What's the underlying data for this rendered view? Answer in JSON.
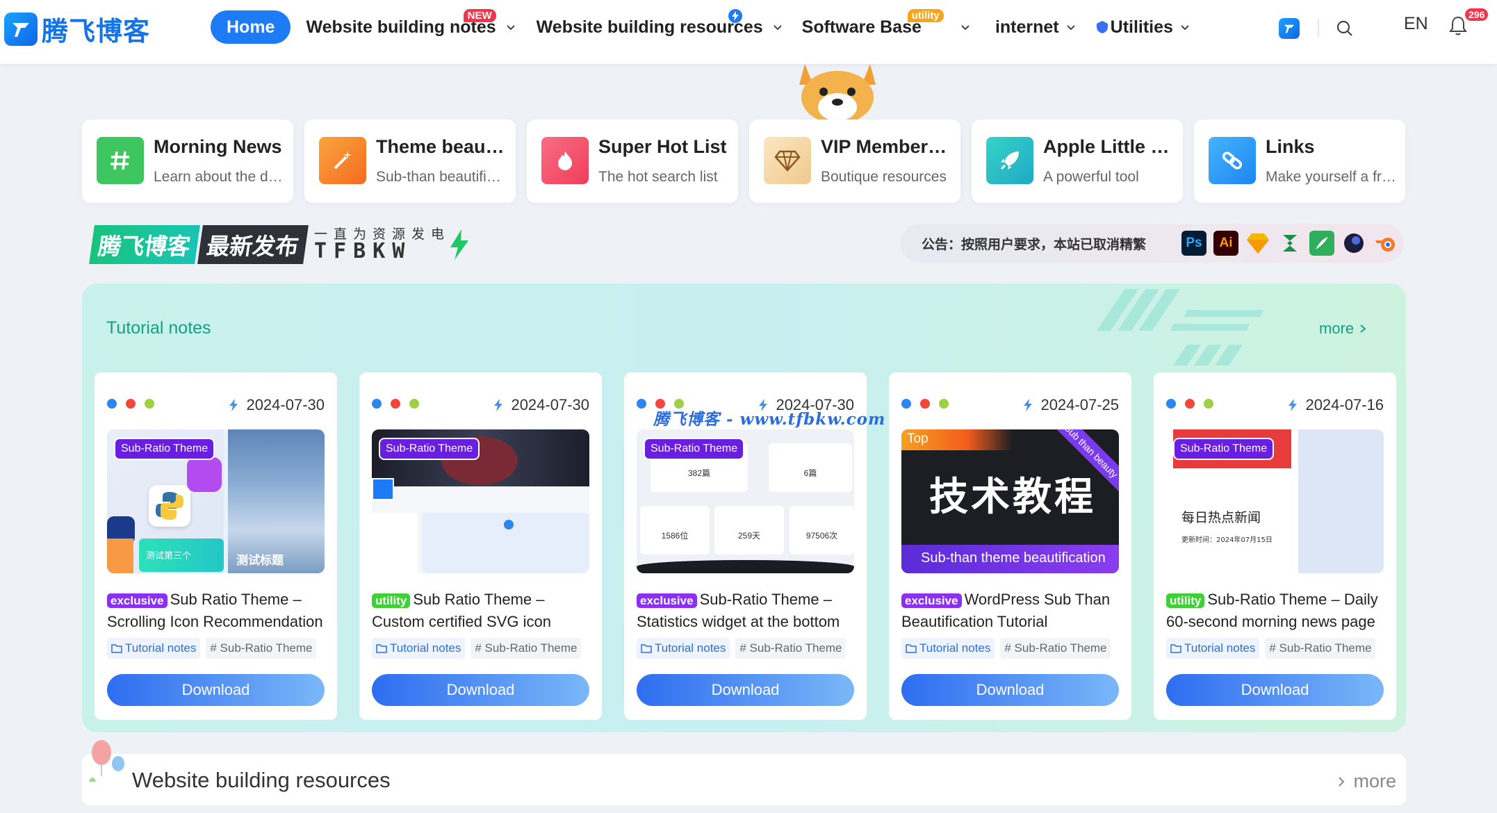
{
  "header": {
    "logo_text": "腾飞博客",
    "nav": [
      {
        "label": "Home",
        "active": true
      },
      {
        "label": "Website building notes",
        "badge": "NEW"
      },
      {
        "label": "Website building resources",
        "badge_icon": "bolt-icon"
      },
      {
        "label": "Software Base",
        "badge": "utility"
      },
      {
        "label": "internet"
      },
      {
        "label": "Utilities"
      }
    ],
    "lang": "EN",
    "notification_count": "296"
  },
  "quick_links": [
    {
      "title": "Morning News",
      "subtitle": "Learn about the daily news",
      "icon": "hash-icon",
      "color": "#3ec760"
    },
    {
      "title": "Theme beautification",
      "subtitle": "Sub-than beautification",
      "icon": "magic-wand-icon",
      "color": "#f7872e"
    },
    {
      "title": "Super Hot List",
      "subtitle": "The hot search list",
      "icon": "fire-icon",
      "color": "#f4526a"
    },
    {
      "title": "VIP Membership",
      "subtitle": "Boutique resources",
      "icon": "diamond-icon",
      "color": "#f3d6a4"
    },
    {
      "title": "Apple Little Rocket",
      "subtitle": "A powerful tool",
      "icon": "rocket-icon",
      "color": "#27c4c8"
    },
    {
      "title": "Links",
      "subtitle": "Make yourself a friend",
      "icon": "link-icon",
      "color": "#2d9ef5"
    }
  ],
  "banner": {
    "brand": "腾飞博客",
    "release": "最新发布",
    "slogan_cn": "一直为资源发电",
    "slogan_en": "TFBKW"
  },
  "notice": {
    "text": "公告：按照用户要求，本站已取消精繁",
    "tools": [
      {
        "name": "photoshop-icon",
        "label": "Ps",
        "bg": "#001d34",
        "fg": "#31a8ff"
      },
      {
        "name": "illustrator-icon",
        "label": "Ai",
        "bg": "#330000",
        "fg": "#ff9a00"
      },
      {
        "name": "sketch-icon",
        "label": "",
        "bg": "transparent",
        "fg": "#f7b500"
      },
      {
        "name": "axure-icon",
        "label": "",
        "bg": "transparent",
        "fg": "#1a8e4a"
      },
      {
        "name": "coreldraw-icon",
        "label": "",
        "bg": "#2fae5b",
        "fg": "#fff"
      },
      {
        "name": "c4d-icon",
        "label": "",
        "bg": "transparent",
        "fg": "#1c1c3c"
      },
      {
        "name": "blender-icon",
        "label": "",
        "bg": "transparent",
        "fg": "#f5792a"
      }
    ]
  },
  "tutorial": {
    "title": "Tutorial notes",
    "more": "more",
    "watermark": "腾飞博客 - www.tfbkw.com",
    "cards": [
      {
        "date": "2024-07-30",
        "ribbon": "Sub-Ratio Theme",
        "tag": "exclusive",
        "title": "Sub Ratio Theme – Scrolling Icon Recommendation",
        "category": "Tutorial notes",
        "tagline": "# Sub-Ratio Theme",
        "download": "Download",
        "thumb_text_a": "测试第三个",
        "thumb_text_b": "测试标题"
      },
      {
        "date": "2024-07-30",
        "ribbon": "Sub-Ratio Theme",
        "tag": "utility",
        "title": "Sub Ratio Theme – Custom certified SVG icon",
        "category": "Tutorial notes",
        "tagline": "# Sub-Ratio Theme",
        "download": "Download"
      },
      {
        "date": "2024-07-30",
        "ribbon": "Sub-Ratio Theme",
        "tag": "exclusive",
        "title": "Sub-Ratio Theme – Statistics widget at the bottom",
        "category": "Tutorial notes",
        "tagline": "# Sub-Ratio Theme",
        "download": "Download",
        "stats": [
          "382篇",
          "6篇",
          "1586位",
          "259天",
          "97506次"
        ]
      },
      {
        "date": "2024-07-25",
        "ribbon": "Top",
        "tag": "exclusive",
        "title": "WordPress Sub Than Beautification Tutorial",
        "category": "Tutorial notes",
        "tagline": "# Sub-Ratio Theme",
        "download": "Download",
        "thumb_big": "技术教程",
        "thumb_corner": "Sub than beauty",
        "thumb_caption": "Sub-than theme beautification"
      },
      {
        "date": "2024-07-16",
        "ribbon": "Sub-Ratio Theme",
        "tag": "utility",
        "title": "Sub-Ratio Theme – Daily 60-second morning news page",
        "category": "Tutorial notes",
        "tagline": "# Sub-Ratio Theme",
        "download": "Download",
        "thumb_cn": "每日热点新闻",
        "thumb_date": "更新时间：2024年07月15日"
      }
    ]
  },
  "bottom_section": {
    "title": "Website building resources",
    "more": "more"
  }
}
